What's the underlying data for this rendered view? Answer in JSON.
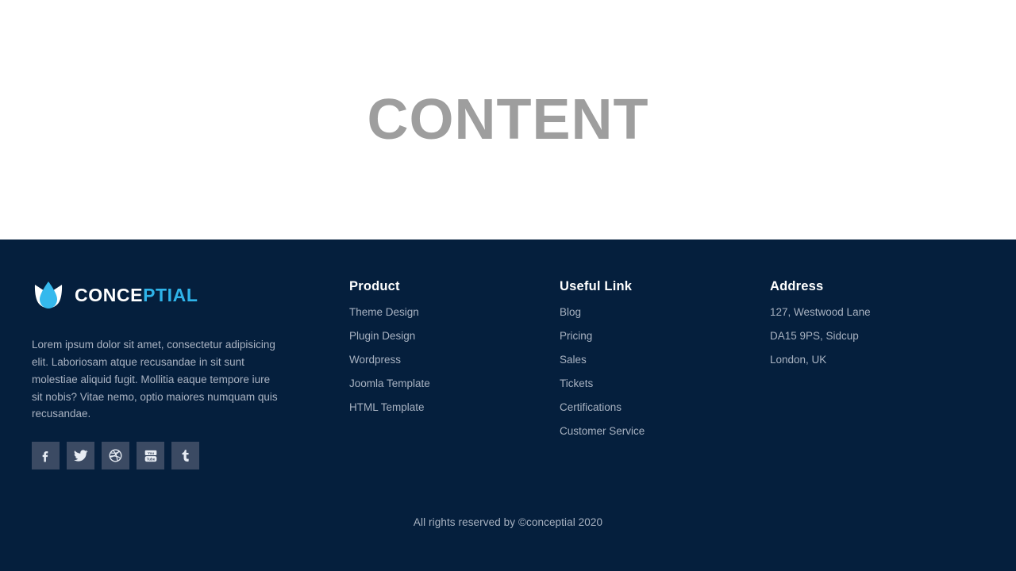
{
  "content": {
    "title": "CONTENT"
  },
  "footer": {
    "brand": {
      "logo_icon": "water-drop-logo-icon",
      "name_part_light": "CONCE",
      "name_part_accent": "PTIAL",
      "description": "Lorem ipsum dolor sit amet, consectetur adipisicing elit. Laboriosam atque recusandae in sit sunt molestiae aliquid fugit. Mollitia eaque tempore iure sit nobis? Vitae nemo, optio maiores numquam quis recusandae.",
      "social": [
        {
          "name": "facebook-icon",
          "label": "Facebook"
        },
        {
          "name": "twitter-icon",
          "label": "Twitter"
        },
        {
          "name": "dribbble-icon",
          "label": "Dribbble"
        },
        {
          "name": "youtube-icon",
          "label": "YouTube"
        },
        {
          "name": "tumblr-icon",
          "label": "Tumblr"
        }
      ]
    },
    "columns": [
      {
        "id": "product",
        "title": "Product",
        "items": [
          "Theme Design",
          "Plugin Design",
          "Wordpress",
          "Joomla Template",
          "HTML Template"
        ]
      },
      {
        "id": "useful-link",
        "title": "Useful Link",
        "items": [
          "Blog",
          "Pricing",
          "Sales",
          "Tickets",
          "Certifications",
          "Customer Service"
        ]
      },
      {
        "id": "address",
        "title": "Address",
        "items": [
          "127, Westwood Lane",
          "DA15 9PS, Sidcup",
          "London, UK"
        ]
      }
    ],
    "copyright": "All rights reserved by ©conceptial 2020"
  },
  "colors": {
    "footer_background": "#051f3d",
    "content_background": "#ffffff",
    "content_title": "#9e9e9e",
    "accent": "#2fb4e9",
    "muted_text": "#a8b2c1",
    "social_button": "#3b4a63"
  }
}
